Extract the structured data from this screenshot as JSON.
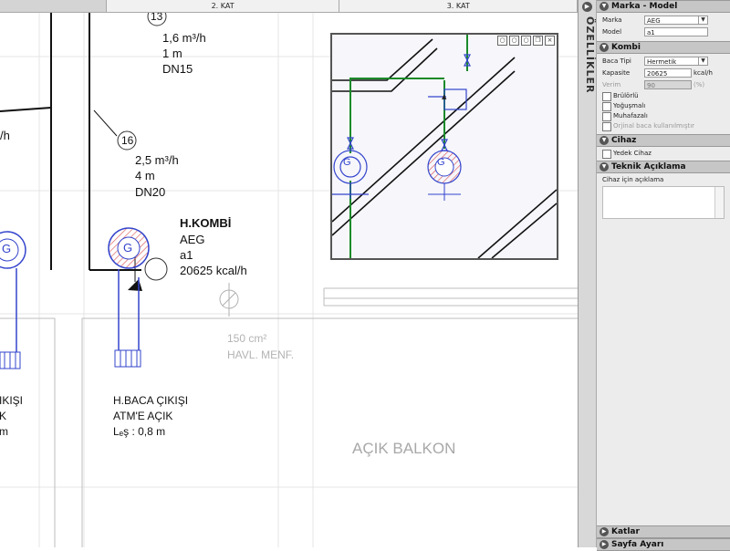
{
  "tabs": [
    {
      "label": "",
      "active": true
    },
    {
      "label": "2. KAT",
      "active": false
    },
    {
      "label": "3. KAT",
      "active": false
    }
  ],
  "canvas": {
    "tag13": "13",
    "tag16": "16",
    "upper_flow": "1,6 m³/h",
    "upper_len": "1 m",
    "upper_dn": "DN15",
    "lower_flow": "2,5 m³/h",
    "lower_len": "4 m",
    "lower_dn": "DN20",
    "left_partial_h": "/h",
    "left_partial_h2": "/h",
    "boiler_title": "H.KOMBİ",
    "boiler_brand": "AEG",
    "boiler_model": "a1",
    "boiler_capacity": "20625 kcal/h",
    "meter_symbol": "G",
    "vent_area": "150 cm²",
    "vent_label": "HAVL. MENF.",
    "flue_title": "H.BACA ÇIKIŞI",
    "flue_sub": "ATM'E AÇIK",
    "flue_leq": "Lₑş : 0,8 m",
    "left_flue_partial": "IKIŞI",
    "left_partial_k": "K",
    "left_partial_m": "m",
    "balcony": "AÇIK BALKON"
  },
  "side_strip": {
    "label": "ÖZELLİKLER"
  },
  "panel": {
    "marka_header": "Marka - Model",
    "marka_label": "Marka",
    "marka_value": "AEG",
    "model_label": "Model",
    "model_value": "a1",
    "kombi_header": "Kombi",
    "baca_label": "Baca Tipi",
    "baca_value": "Hermetik",
    "kapasite_label": "Kapasite",
    "kapasite_value": "20625",
    "kapasite_unit": "kcal/h",
    "verim_label": "Verim",
    "verim_value": "90",
    "verim_unit": "(%)",
    "chk_brulor": "Brülörlü",
    "chk_yogusmali": "Yoğuşmalı",
    "chk_muhafazali": "Muhafazalı",
    "chk_orjinal": "Orjinal baca kullanılmıştır",
    "cihaz_header": "Cihaz",
    "chk_yedek": "Yedek Cihaz",
    "teknik_header": "Teknik Açıklama",
    "cihaz_aciklama_label": "Cihaz için açıklama",
    "katlar_header": "Katlar",
    "sayfa_header": "Sayfa Ayarı"
  }
}
